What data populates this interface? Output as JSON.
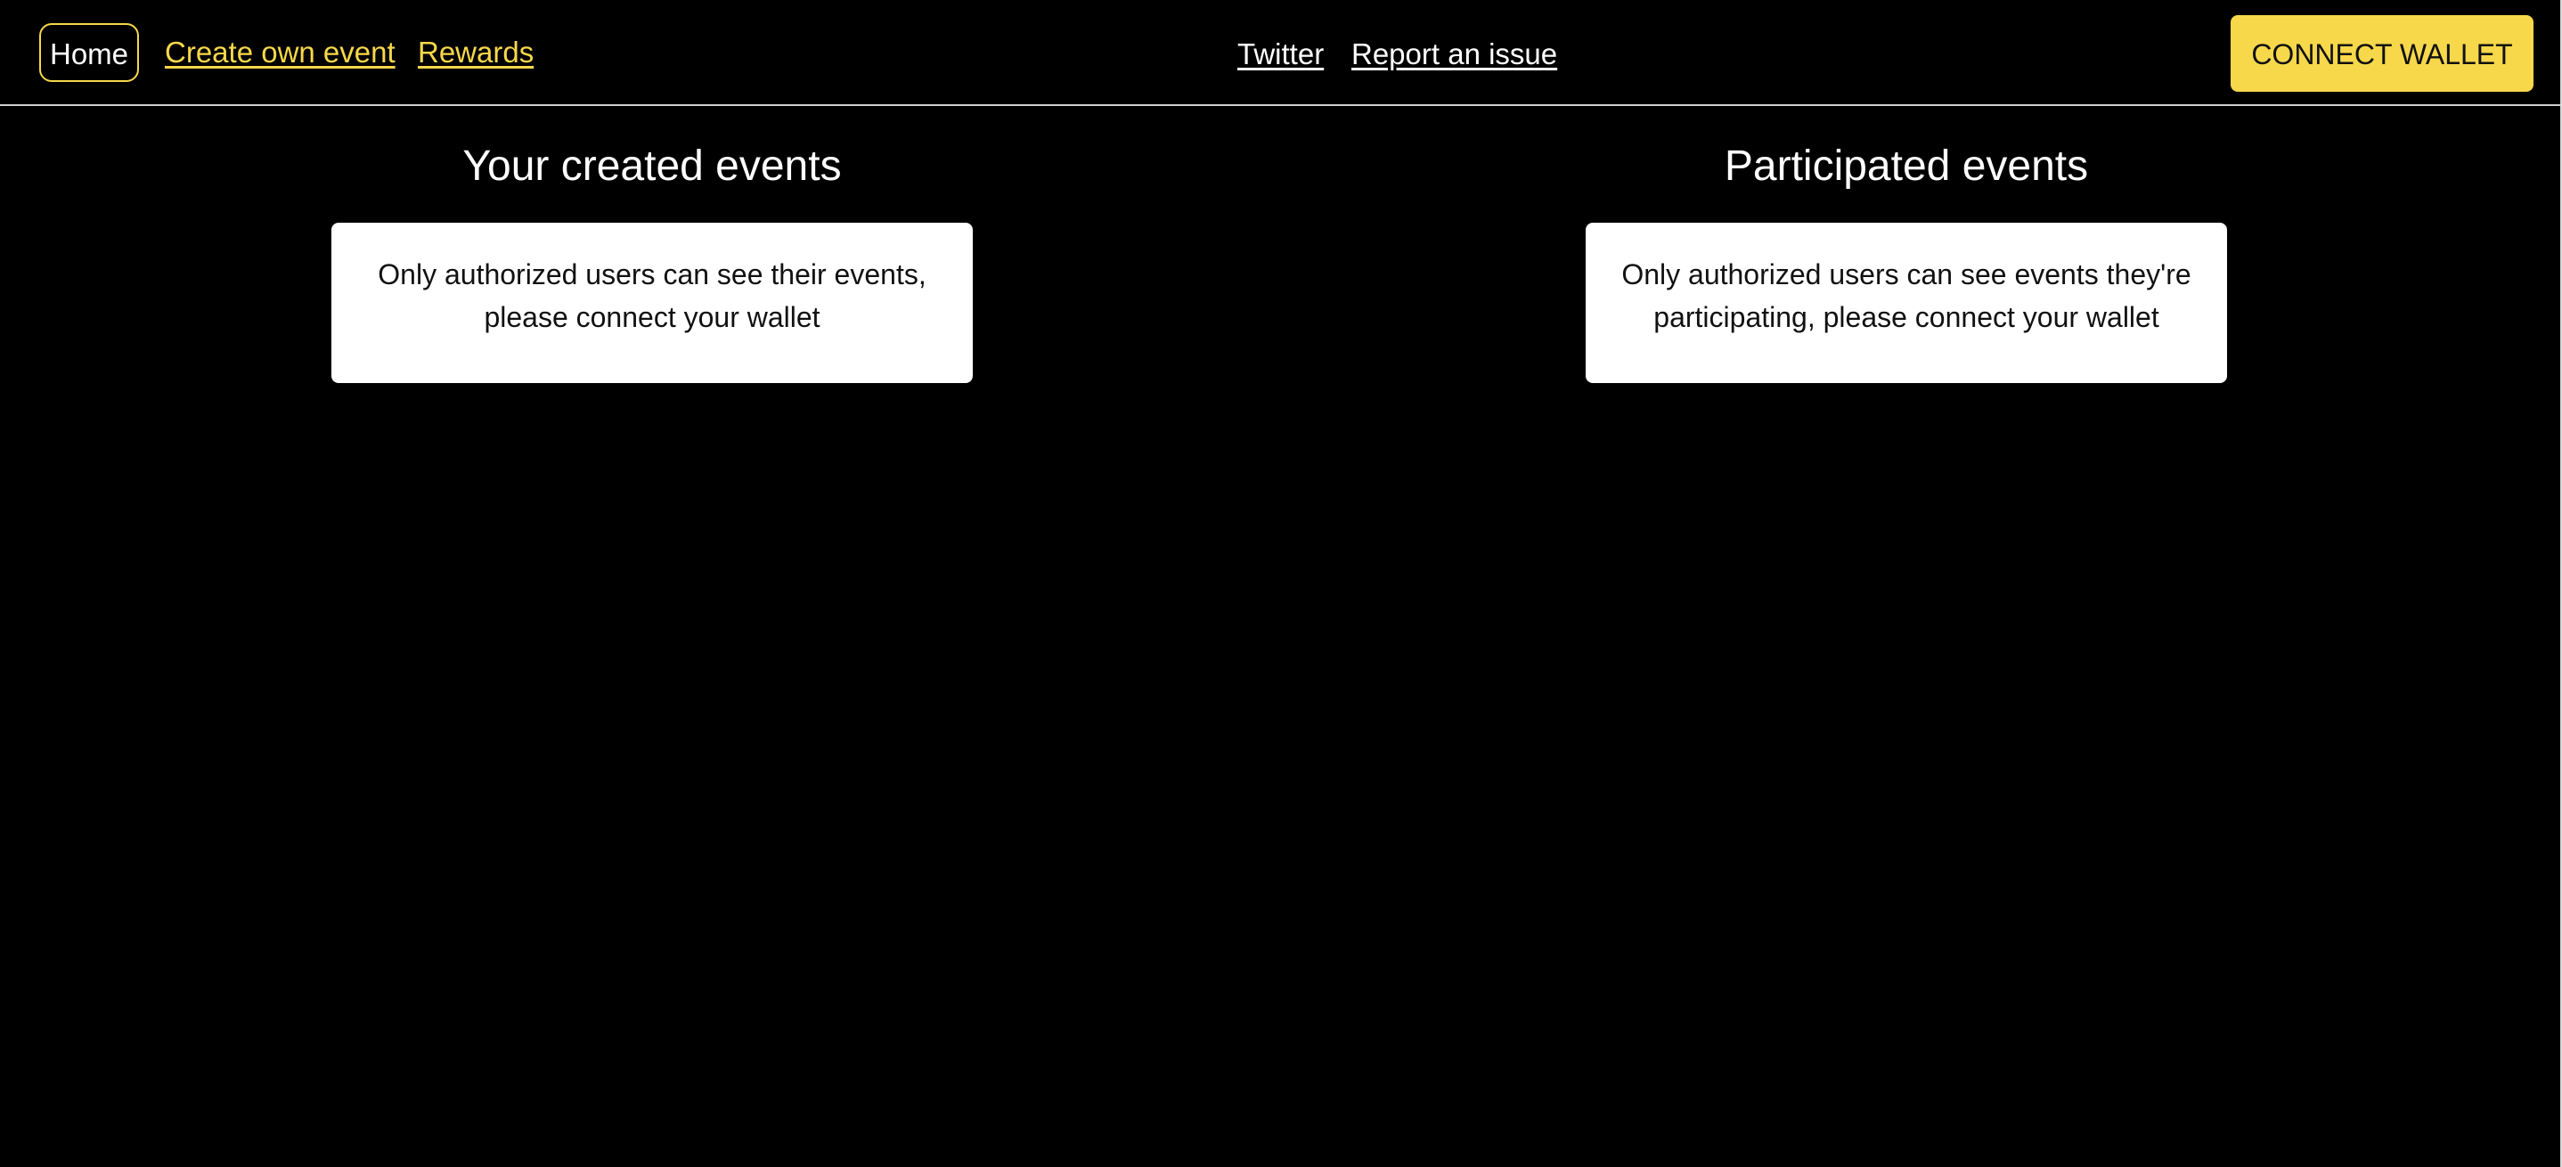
{
  "header": {
    "nav": {
      "home": "Home",
      "create_event": "Create own event",
      "rewards": "Rewards",
      "twitter": "Twitter",
      "report_issue": "Report an issue"
    },
    "connect_wallet": "CONNECT WALLET"
  },
  "main": {
    "created": {
      "title": "Your created events",
      "notice": "Only authorized users can see their events, please connect your wallet"
    },
    "participated": {
      "title": "Participated events",
      "notice": "Only authorized users can see events they're participating, please connect your wallet"
    }
  },
  "colors": {
    "background": "#000000",
    "accent": "#f7d84a",
    "text_light": "#ffffff",
    "card": "#ffffff"
  }
}
